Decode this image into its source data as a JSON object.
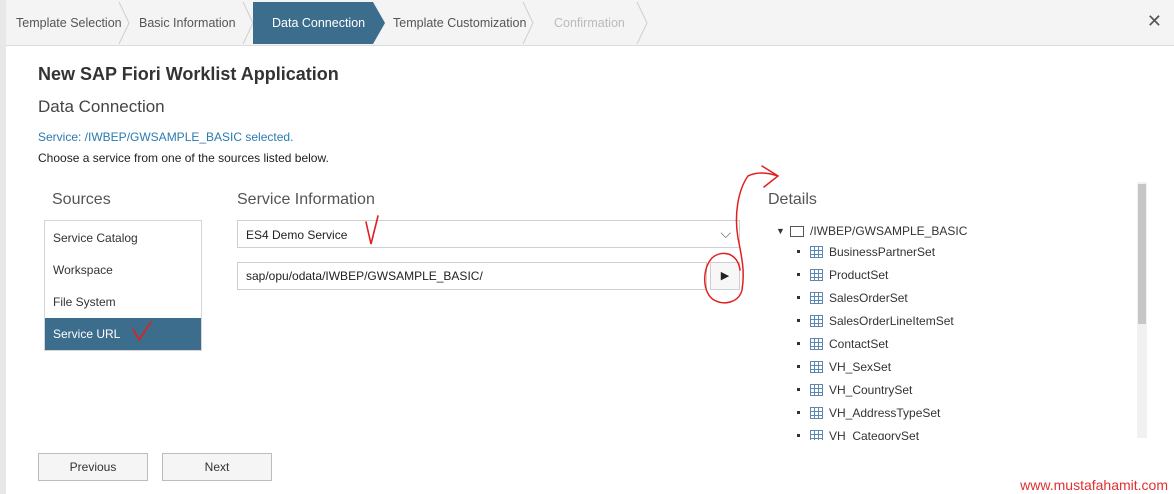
{
  "wizard": {
    "steps": [
      {
        "label": "Template Selection",
        "state": "done"
      },
      {
        "label": "Basic Information",
        "state": "done"
      },
      {
        "label": "Data Connection",
        "state": "active"
      },
      {
        "label": "Template Customization",
        "state": "pending"
      },
      {
        "label": "Confirmation",
        "state": "disabled"
      }
    ],
    "close_label": "✕"
  },
  "page": {
    "title": "New SAP Fiori Worklist Application",
    "subtitle": "Data Connection",
    "status": "Service: /IWBEP/GWSAMPLE_BASIC selected.",
    "hint": "Choose a service from one of the sources listed below."
  },
  "sources": {
    "heading": "Sources",
    "items": [
      "Service Catalog",
      "Workspace",
      "File System",
      "Service URL"
    ],
    "selected": "Service URL"
  },
  "service_info": {
    "heading": "Service Information",
    "system_value": "ES4 Demo Service",
    "url_value": "sap/opu/odata/IWBEP/GWSAMPLE_BASIC/",
    "run_icon": "play-icon"
  },
  "details": {
    "heading": "Details",
    "root": "/IWBEP/GWSAMPLE_BASIC",
    "entities": [
      "BusinessPartnerSet",
      "ProductSet",
      "SalesOrderSet",
      "SalesOrderLineItemSet",
      "ContactSet",
      "VH_SexSet",
      "VH_CountrySet",
      "VH_AddressTypeSet",
      "VH_CategorySet"
    ]
  },
  "footer": {
    "previous_label": "Previous",
    "next_label": "Next"
  },
  "watermark": "www.mustafahamit.com",
  "colors": {
    "accent": "#3d6d8d",
    "link": "#2a7ab0",
    "annotation": "#e02020"
  }
}
